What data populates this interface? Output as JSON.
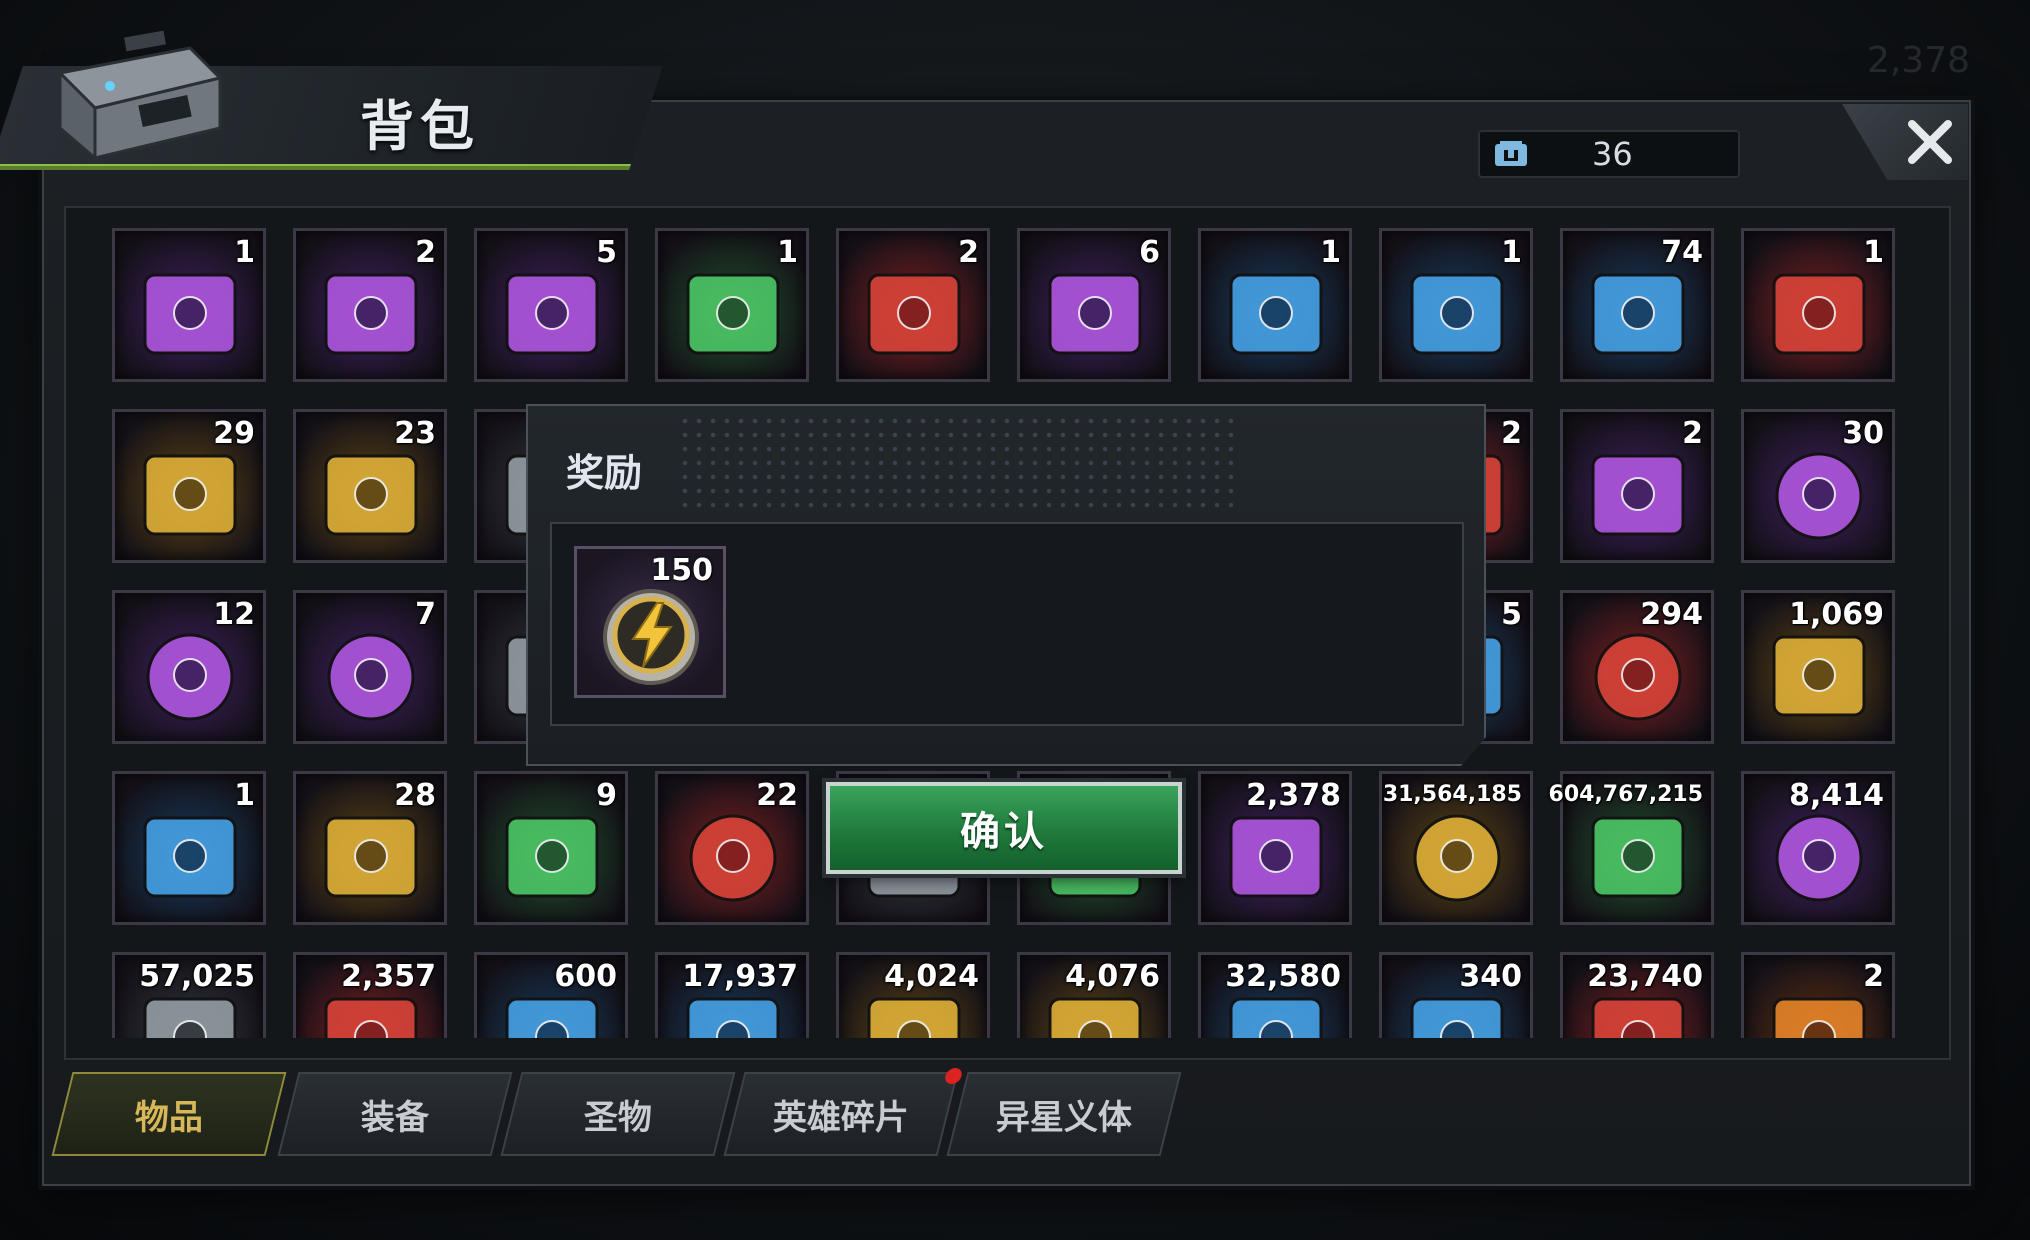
{
  "window": {
    "title": "背包",
    "capacity_value": "36"
  },
  "background": {
    "hud_value": "2,378"
  },
  "tabs": [
    {
      "label": "物品",
      "active": true
    },
    {
      "label": "装备",
      "active": false
    },
    {
      "label": "圣物",
      "active": false
    },
    {
      "label": "英雄碎片",
      "active": false,
      "has_alert_dot": true
    },
    {
      "label": "异星义体",
      "active": false
    }
  ],
  "items": [
    {
      "icon": "sss-chest-iii-icon",
      "count": "1"
    },
    {
      "icon": "purple-chest-lv5-icon",
      "count": "2"
    },
    {
      "icon": "purple-chest-lv1-icon",
      "count": "5"
    },
    {
      "icon": "green-supply-crate-icon",
      "count": "1"
    },
    {
      "icon": "red-supply-crate-icon",
      "count": "2"
    },
    {
      "icon": "ss-chained-chest-icon",
      "count": "6"
    },
    {
      "icon": "s-chained-chest-icon",
      "count": "1"
    },
    {
      "icon": "tier-iv-capsule-icon",
      "count": "1"
    },
    {
      "icon": "warp-device-icon",
      "count": "74"
    },
    {
      "icon": "red-gift-bag-icon",
      "count": "1"
    },
    {
      "icon": "speedup-24h-icon",
      "count": "29"
    },
    {
      "icon": "speedup-12h-icon",
      "count": "23"
    },
    {
      "icon": "hidden-item-icon",
      "count": ""
    },
    {
      "icon": "hidden-item-icon",
      "count": ""
    },
    {
      "icon": "hidden-item-icon",
      "count": ""
    },
    {
      "icon": "hidden-item-icon",
      "count": ""
    },
    {
      "icon": "hidden-item-icon",
      "count": ""
    },
    {
      "icon": "red-item-icon",
      "count": "2"
    },
    {
      "icon": "purple-cube-icon",
      "count": "2"
    },
    {
      "icon": "film-reel-icon",
      "count": "30"
    },
    {
      "icon": "pink-bottlecap-icon",
      "count": "12"
    },
    {
      "icon": "purple-spade-chip-icon",
      "count": "7"
    },
    {
      "icon": "hidden-item-icon",
      "count": ""
    },
    {
      "icon": "hidden-item-icon",
      "count": ""
    },
    {
      "icon": "hidden-item-icon",
      "count": ""
    },
    {
      "icon": "hidden-item-icon",
      "count": ""
    },
    {
      "icon": "hidden-item-icon",
      "count": ""
    },
    {
      "icon": "blue-item-icon",
      "count": "5"
    },
    {
      "icon": "red-spade-chip-icon",
      "count": "294"
    },
    {
      "icon": "bullet-icon",
      "count": "1,069"
    },
    {
      "icon": "goggles-icon",
      "count": "1"
    },
    {
      "icon": "golden-key-icon",
      "count": "28"
    },
    {
      "icon": "green-hat-s02-icon",
      "count": "9"
    },
    {
      "icon": "christmas-ornament-icon",
      "count": "22"
    },
    {
      "icon": "hidden-item-icon",
      "count": ""
    },
    {
      "icon": "green-item-s02-icon",
      "count": ""
    },
    {
      "icon": "purple-crystal-icon",
      "count": "2,378"
    },
    {
      "icon": "gold-coins-icon",
      "count": "31,564,185"
    },
    {
      "icon": "energy-battery-icon",
      "count": "604,767,215"
    },
    {
      "icon": "purple-orb-icon",
      "count": "8,414"
    },
    {
      "icon": "gear-icon",
      "count": "57,025"
    },
    {
      "icon": "red-network-icon",
      "count": "2,357"
    },
    {
      "icon": "blue-wing-icon",
      "count": "600"
    },
    {
      "icon": "alloy-plate-icon",
      "count": "17,937"
    },
    {
      "icon": "gold-fist-icon",
      "count": "4,024"
    },
    {
      "icon": "gold-star-icon",
      "count": "4,076"
    },
    {
      "icon": "tech-book-icon",
      "count": "32,580"
    },
    {
      "icon": "gold-tech-book-icon",
      "count": "340"
    },
    {
      "icon": "red-tech-book-icon",
      "count": "23,740"
    },
    {
      "icon": "orange-triangle-icon",
      "count": "2"
    }
  ],
  "reward_dialog": {
    "title": "奖励",
    "reward": {
      "icon": "lightning-coin-icon",
      "count": "150"
    },
    "confirm_label": "确认"
  },
  "colors": {
    "confirm_green": "#1f7a3c",
    "active_tab_gold": "#d6b85a",
    "alert_dot": "#dd2222"
  }
}
